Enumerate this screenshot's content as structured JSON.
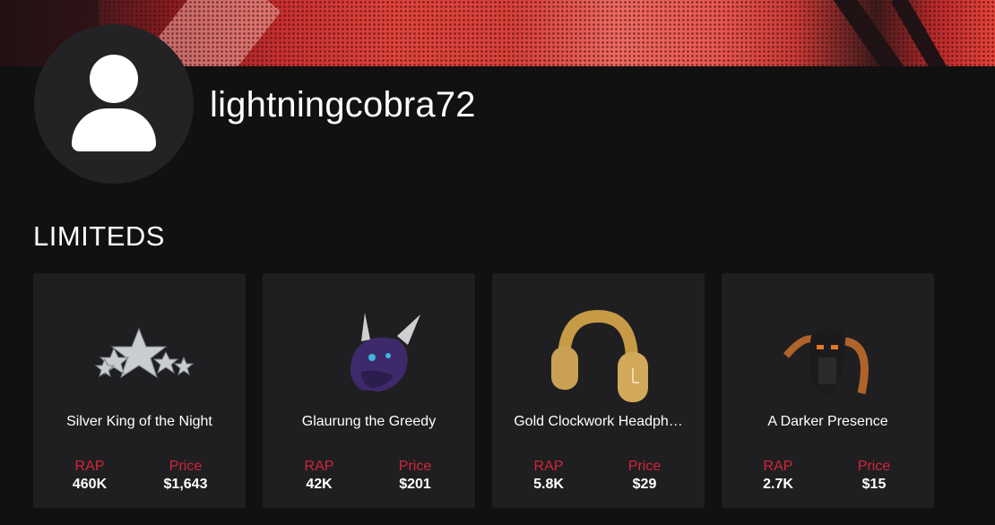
{
  "profile": {
    "username": "lightningcobra72"
  },
  "limiteds": {
    "title": "LIMITEDS",
    "items": [
      {
        "name": "Silver King of the Night",
        "rap_label": "RAP",
        "rap": "460K",
        "price_label": "Price",
        "price": "$1,643"
      },
      {
        "name": "Glaurung the Greedy",
        "rap_label": "RAP",
        "rap": "42K",
        "price_label": "Price",
        "price": "$201"
      },
      {
        "name": "Gold Clockwork Headph…",
        "rap_label": "RAP",
        "rap": "5.8K",
        "price_label": "Price",
        "price": "$29"
      },
      {
        "name": "A Darker Presence",
        "rap_label": "RAP",
        "rap": "2.7K",
        "price_label": "Price",
        "price": "$15"
      }
    ]
  },
  "colors": {
    "background": "#111112",
    "card": "#1f1f21",
    "accent_red": "#d3243b"
  }
}
